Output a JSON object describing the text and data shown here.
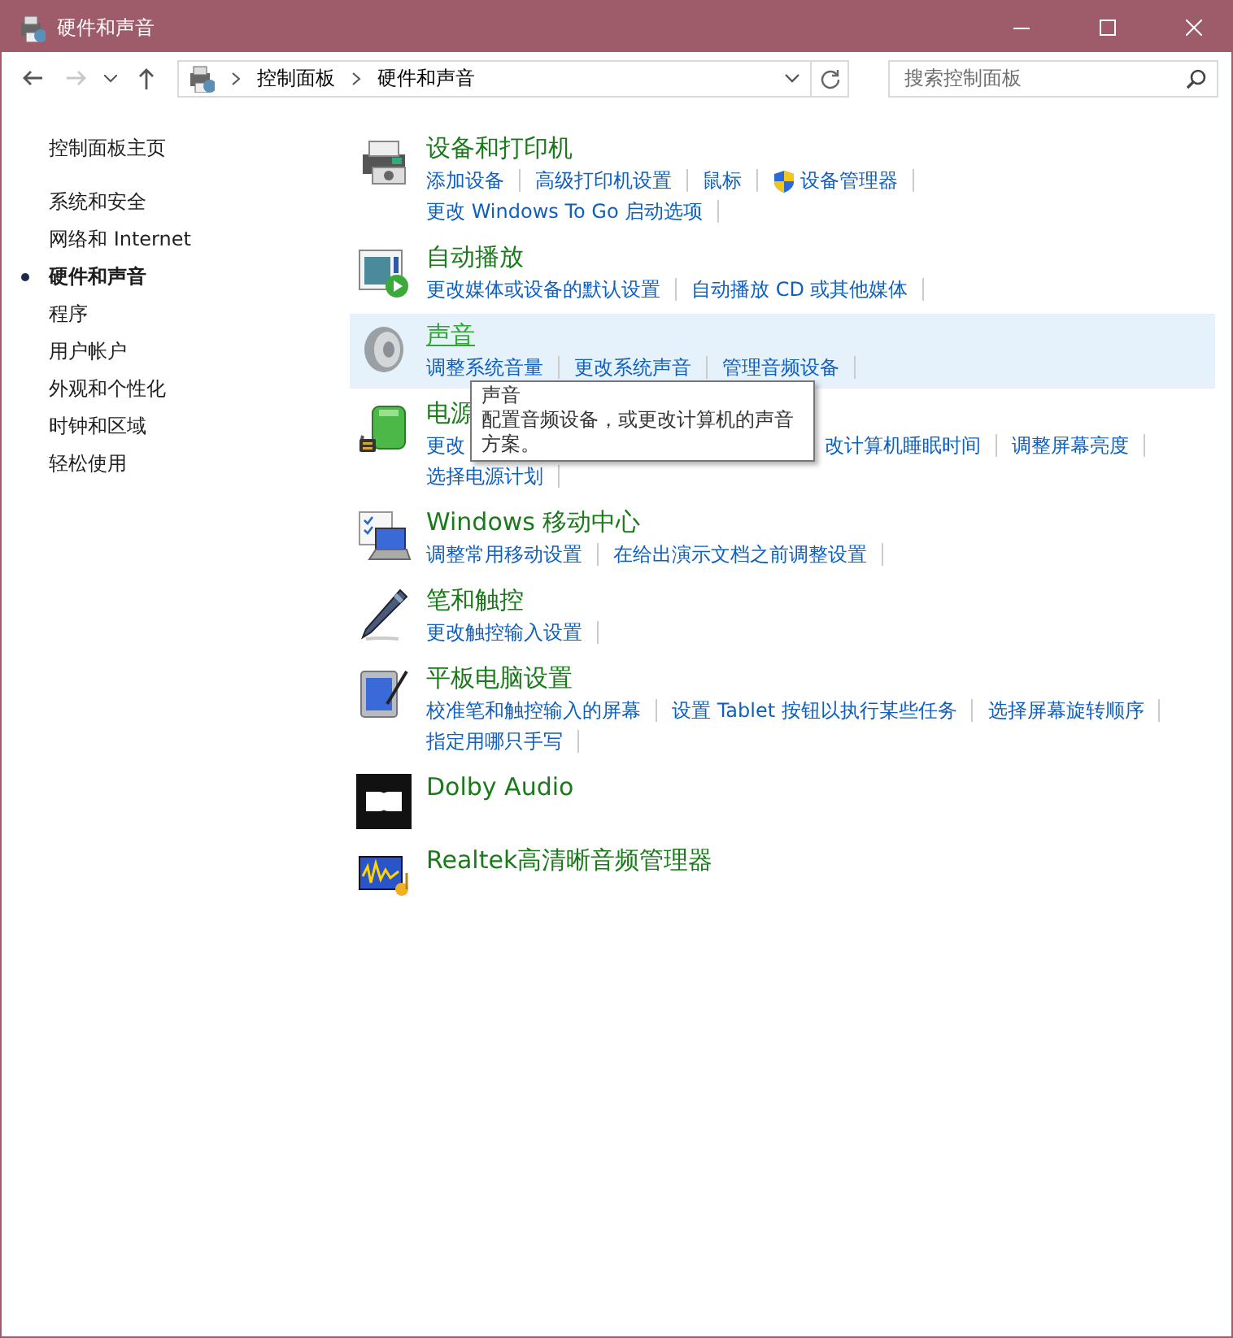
{
  "window": {
    "title": "硬件和声音"
  },
  "address_bar": {
    "breadcrumbs": [
      "控制面板",
      "硬件和声音"
    ],
    "back_disabled": false,
    "forward_disabled": true
  },
  "search": {
    "placeholder": "搜索控制面板"
  },
  "sidebar": {
    "home": "控制面板主页",
    "items": [
      {
        "label": "系统和安全",
        "selected": false
      },
      {
        "label": "网络和 Internet",
        "selected": false
      },
      {
        "label": "硬件和声音",
        "selected": true
      },
      {
        "label": "程序",
        "selected": false
      },
      {
        "label": "用户帐户",
        "selected": false
      },
      {
        "label": "外观和个性化",
        "selected": false
      },
      {
        "label": "时钟和区域",
        "selected": false
      },
      {
        "label": "轻松使用",
        "selected": false
      }
    ]
  },
  "sections": [
    {
      "title": "设备和打印机",
      "hovered": false,
      "links": [
        {
          "label": "添加设备",
          "kind": "plain"
        },
        {
          "label": "高级打印机设置",
          "kind": "plain"
        },
        {
          "label": "鼠标",
          "kind": "plain"
        },
        {
          "label": "设备管理器",
          "kind": "shield"
        },
        {
          "label": "更改 Windows To Go 启动选项",
          "kind": "plain"
        }
      ]
    },
    {
      "title": "自动播放",
      "hovered": false,
      "links": [
        {
          "label": "更改媒体或设备的默认设置",
          "kind": "plain"
        },
        {
          "label": "自动播放 CD 或其他媒体",
          "kind": "plain"
        }
      ]
    },
    {
      "title": "声音",
      "hovered": true,
      "links": [
        {
          "label": "调整系统音量",
          "kind": "plain"
        },
        {
          "label": "更改系统声音",
          "kind": "plain"
        },
        {
          "label": "管理音频设备",
          "kind": "plain"
        }
      ],
      "tooltip": {
        "title": "声音",
        "text": "配置音频设备，或更改计算机的声音方案。"
      }
    },
    {
      "title": "电源",
      "hovered": false,
      "links": [
        {
          "label": "更改",
          "kind": "covered"
        },
        {
          "label": "改计算机睡眠时间",
          "kind": "plain"
        },
        {
          "label": "调整屏幕亮度",
          "kind": "plain"
        },
        {
          "label": "选择电源计划",
          "kind": "plain"
        }
      ]
    },
    {
      "title": "Windows 移动中心",
      "hovered": false,
      "links": [
        {
          "label": "调整常用移动设置",
          "kind": "plain"
        },
        {
          "label": "在给出演示文档之前调整设置",
          "kind": "plain"
        }
      ]
    },
    {
      "title": "笔和触控",
      "hovered": false,
      "links": [
        {
          "label": "更改触控输入设置",
          "kind": "plain"
        }
      ]
    },
    {
      "title": "平板电脑设置",
      "hovered": false,
      "links": [
        {
          "label": "校准笔和触控输入的屏幕",
          "kind": "plain"
        },
        {
          "label": "设置 Tablet 按钮以执行某些任务",
          "kind": "plain"
        },
        {
          "label": "选择屏幕旋转顺序",
          "kind": "plain"
        },
        {
          "label": "指定用哪只手写",
          "kind": "plain"
        }
      ]
    },
    {
      "title": "Dolby Audio",
      "hovered": false
    },
    {
      "title": "Realtek高清晰音频管理器",
      "hovered": false
    }
  ]
}
